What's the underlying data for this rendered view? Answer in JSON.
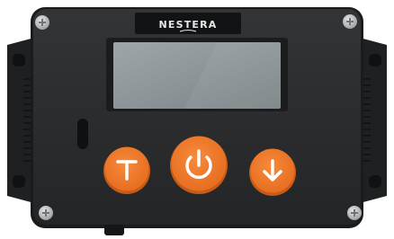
{
  "device": {
    "brand": "NESTERA",
    "colors": {
      "body": "#2a2b2d",
      "body_edge": "#1a1b1c",
      "side_bracket": "#1f2021",
      "screen": "#8f979a",
      "screen_bezel": "#1b1c1d",
      "accent": "#f07a2b",
      "accent_dark": "#d1611a",
      "screw": "#c9ccce"
    },
    "buttons": [
      {
        "name": "up-button",
        "icon": "arrow-up-icon"
      },
      {
        "name": "power-button",
        "icon": "power-icon"
      },
      {
        "name": "down-button",
        "icon": "arrow-down-icon"
      }
    ]
  }
}
